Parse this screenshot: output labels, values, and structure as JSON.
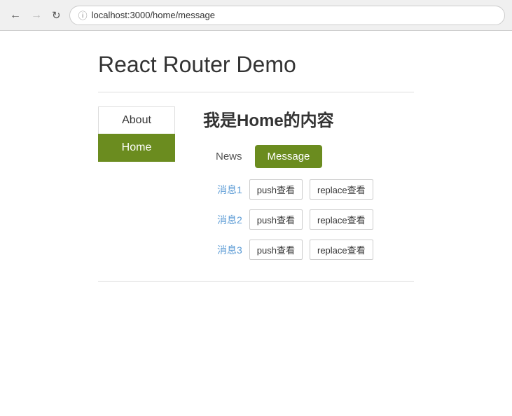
{
  "browser": {
    "url": "localhost:3000/home/message",
    "info_icon": "ⓘ",
    "back_btn": "←",
    "forward_btn": "→",
    "refresh_btn": "↻"
  },
  "page": {
    "title": "React Router Demo"
  },
  "left_nav": {
    "items": [
      {
        "label": "About",
        "active": false
      },
      {
        "label": "Home",
        "active": true
      }
    ]
  },
  "home_content": {
    "heading": "我是Home的内容",
    "sub_nav": [
      {
        "label": "News",
        "active": false
      },
      {
        "label": "Message",
        "active": true
      }
    ],
    "messages": [
      {
        "link": "消息1",
        "push_label": "push查看",
        "replace_label": "replace查看"
      },
      {
        "link": "消息2",
        "push_label": "push查看",
        "replace_label": "replace查看"
      },
      {
        "link": "消息3",
        "push_label": "push查看",
        "replace_label": "replace查看"
      }
    ]
  }
}
